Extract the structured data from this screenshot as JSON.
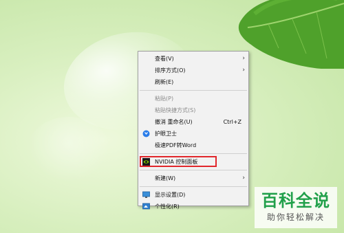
{
  "menu": {
    "view": "查看(V)",
    "sort": "排序方式(O)",
    "refresh": "刷新(E)",
    "paste": "粘贴(P)",
    "paste_shortcut": "粘贴快捷方式(S)",
    "undo": "撤消 重命名(U)",
    "undo_shortcut": "Ctrl+Z",
    "guard": "护眼卫士",
    "pdf_to_word": "极速PDF转Word",
    "nvidia": "NVIDIA 控制面板",
    "new": "新建(W)",
    "display": "显示设置(D)",
    "personalize": "个性化(R)"
  },
  "icons": {
    "guard": "guard-icon",
    "nvidia": "nvidia-icon",
    "display": "display-icon",
    "personalize": "personalize-icon"
  },
  "watermark": {
    "title": "百科全说",
    "subtitle": "助你轻松解决"
  },
  "colors": {
    "highlight": "#e1262b",
    "watermark_green": "#21a04a",
    "nvidia_green": "#76b900",
    "guard_blue": "#2b7de9"
  }
}
